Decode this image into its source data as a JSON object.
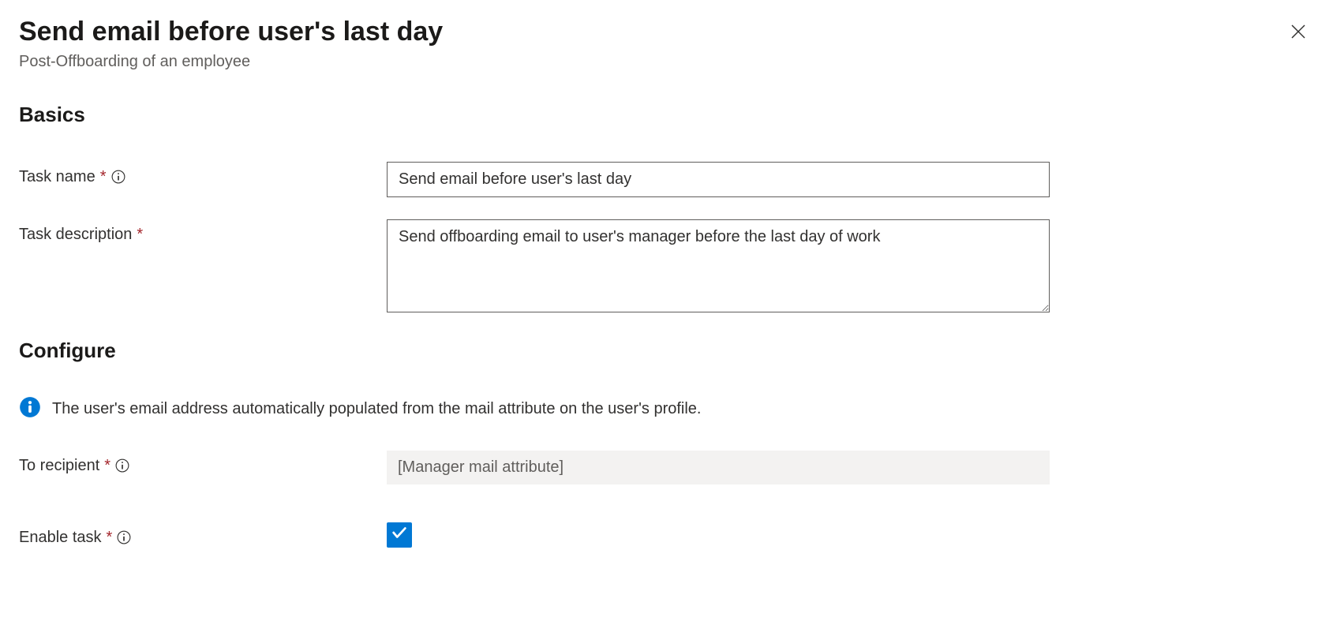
{
  "header": {
    "title": "Send email before user's last day",
    "subtitle": "Post-Offboarding of an employee"
  },
  "sections": {
    "basics": {
      "heading": "Basics",
      "task_name": {
        "label": "Task name",
        "value": "Send email before user's last day"
      },
      "task_description": {
        "label": "Task description",
        "value": "Send offboarding email to user's manager before the last day of work"
      }
    },
    "configure": {
      "heading": "Configure",
      "info_message": "The user's email address automatically populated from the mail attribute on the user's profile.",
      "to_recipient": {
        "label": "To recipient",
        "value": "[Manager mail attribute]"
      },
      "enable_task": {
        "label": "Enable task",
        "checked": true
      }
    }
  }
}
